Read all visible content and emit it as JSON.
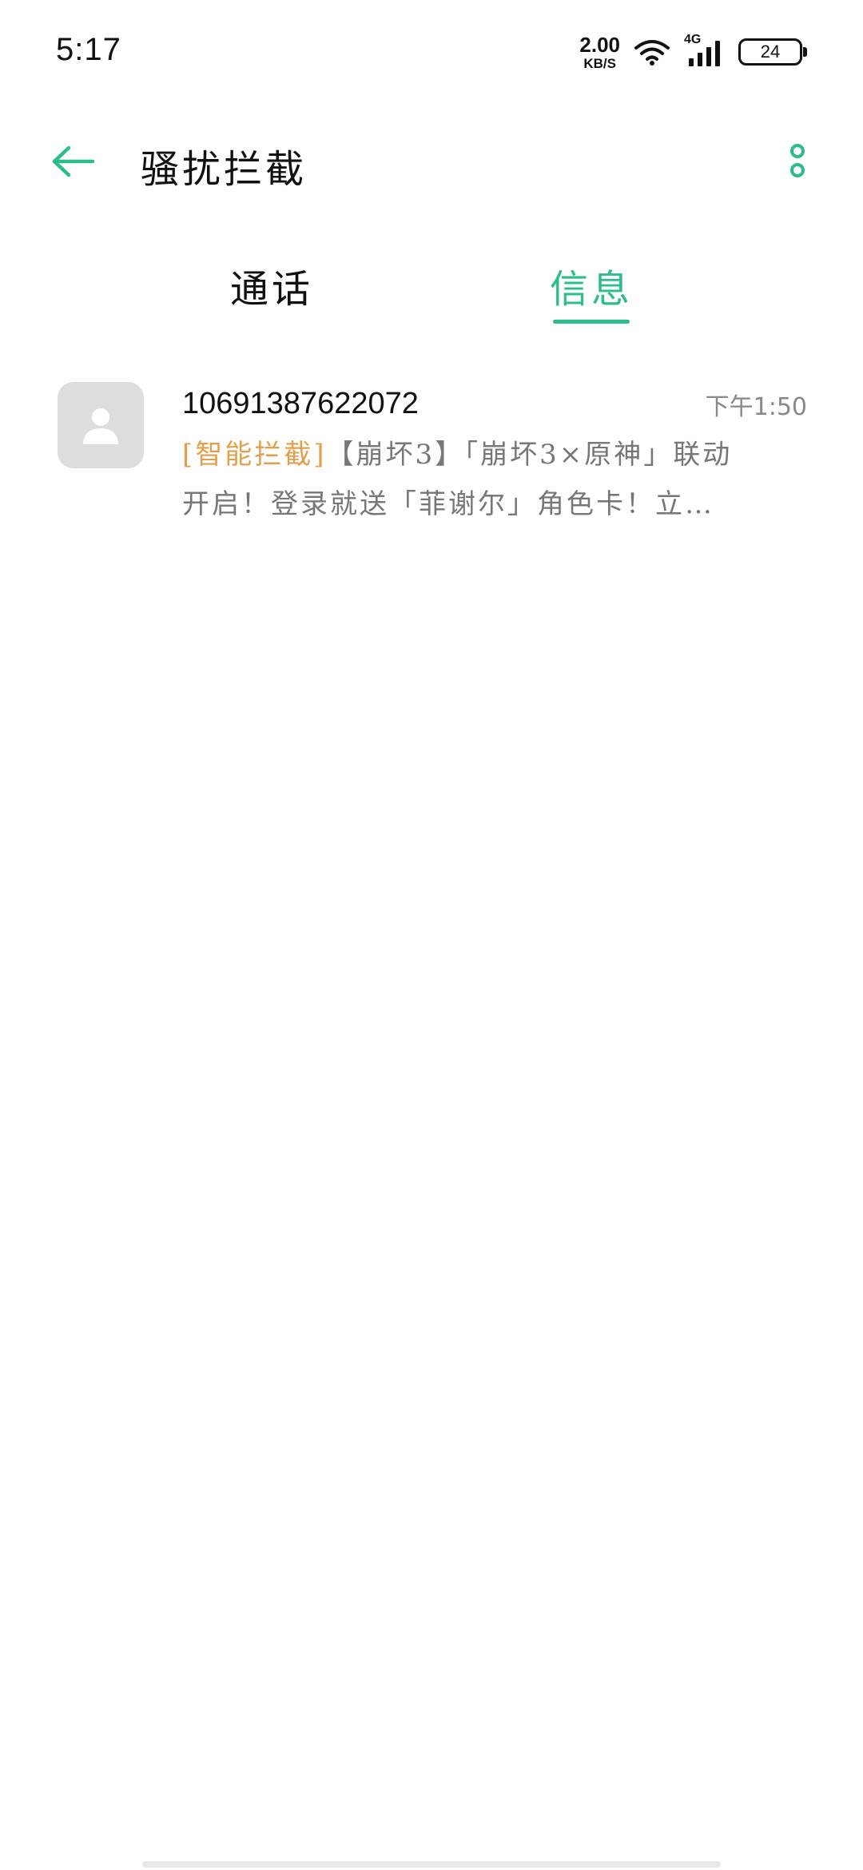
{
  "status_bar": {
    "time": "5:17",
    "net_speed_value": "2.00",
    "net_speed_unit": "KB/S",
    "network_type": "4G",
    "battery_level": "24"
  },
  "header": {
    "title": "骚扰拦截"
  },
  "tabs": [
    {
      "label": "通话",
      "active": false
    },
    {
      "label": "信息",
      "active": true
    }
  ],
  "messages": [
    {
      "sender": "10691387622072",
      "time": "下午1:50",
      "tag": "[智能拦截]",
      "preview": "【崩坏3】「崩坏3×原神」联动开启！登录就送「菲谢尔」角色卡！立即…"
    }
  ],
  "colors": {
    "accent": "#2dbd8a",
    "tag": "#e3a04c",
    "avatar_bg": "#dddddd"
  },
  "icons": {
    "back": "arrow-left-icon",
    "more": "more-vertical-icon",
    "avatar": "person-icon",
    "wifi": "wifi-icon",
    "signal": "signal-icon",
    "battery": "battery-icon"
  }
}
